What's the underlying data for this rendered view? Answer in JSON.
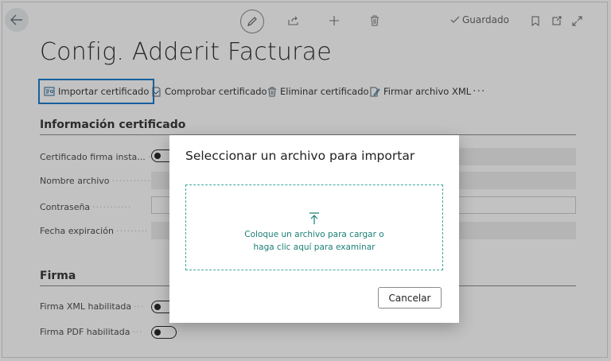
{
  "header": {
    "saved_label": "Guardado",
    "icons": [
      "back-arrow-icon",
      "pencil-icon",
      "share-icon",
      "plus-icon",
      "trash-icon",
      "check-icon",
      "bookmark-icon",
      "popout-icon",
      "expand-icon"
    ]
  },
  "page": {
    "title": "Config. Adderit Facturae"
  },
  "actions": [
    {
      "label": "Importar certificado",
      "icon": "import-certificate-icon"
    },
    {
      "label": "Comprobar certificado",
      "icon": "check-certificate-icon"
    },
    {
      "label": "Eliminar certificado",
      "icon": "delete-certificate-icon"
    },
    {
      "label": "Firmar archivo XML",
      "icon": "sign-file-icon"
    },
    {
      "label": "···",
      "icon": "more-icon"
    }
  ],
  "sections": {
    "certificate": {
      "title": "Información certificado",
      "fields": [
        {
          "label": "Certificado firma insta..."
        },
        {
          "label": "Nombre archivo"
        },
        {
          "label": "Contraseña"
        },
        {
          "label": "Fecha expiración"
        }
      ]
    },
    "signature": {
      "title": "Firma",
      "fields": [
        {
          "label": "Firma XML habilitada"
        },
        {
          "label": "Firma PDF habilitada"
        }
      ]
    }
  },
  "dialog": {
    "title": "Seleccionar un archivo para importar",
    "drop_text": "Coloque un archivo para cargar o haga clic aquí para examinar",
    "cancel_label": "Cancelar"
  },
  "colors": {
    "accent_blue": "#1f7fd0",
    "dropzone_teal": "#3fa89a",
    "drop_text": "#1a7f76"
  }
}
